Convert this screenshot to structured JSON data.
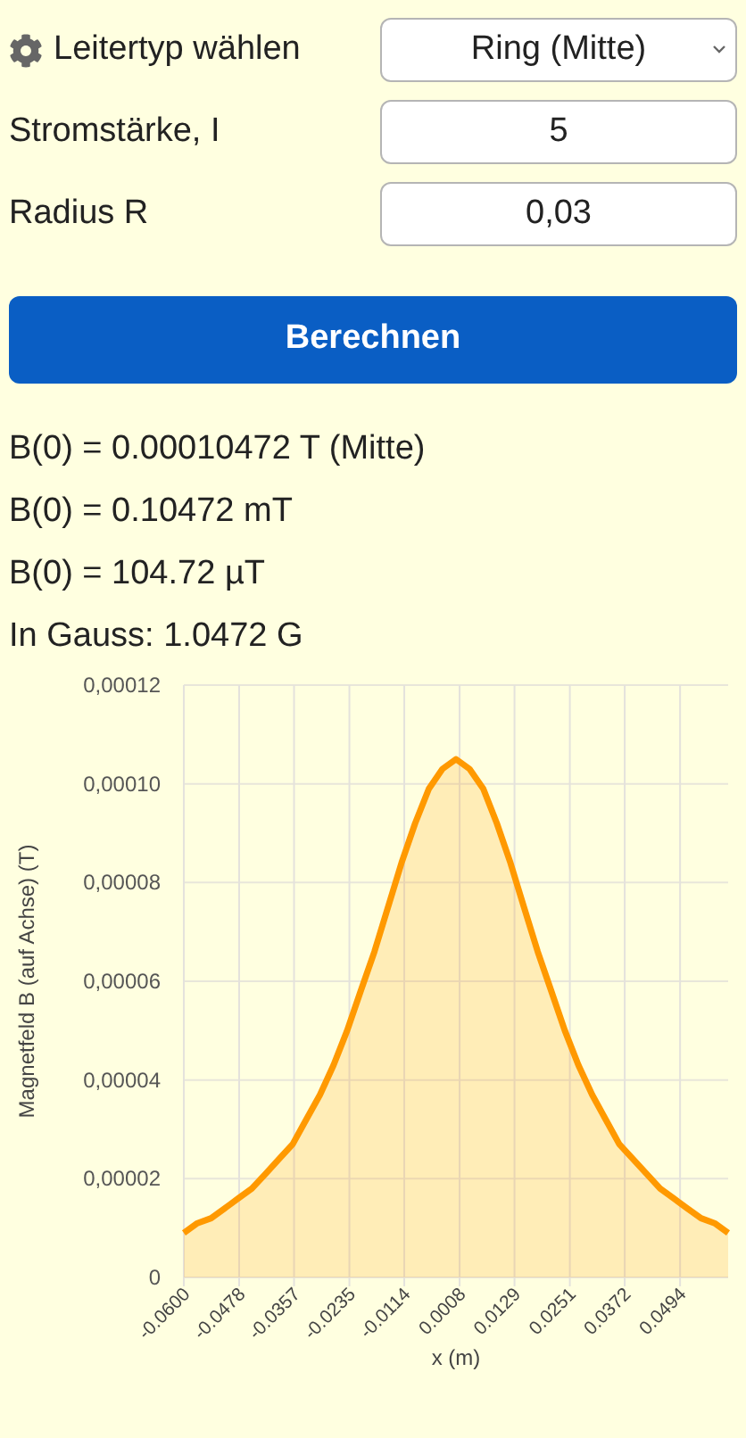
{
  "form": {
    "type_label": "Leitertyp wählen",
    "type_value": "Ring (Mitte)",
    "current_label": "Stromstärke, I",
    "current_value": "5",
    "radius_label": "Radius R",
    "radius_value": "0,03"
  },
  "button": "Berechnen",
  "results": [
    "B(0) = 0.00010472 T (Mitte)",
    "B(0) = 0.10472 mT",
    "B(0) = 104.72 µT",
    "In Gauss: 1.0472 G"
  ],
  "chart_data": {
    "type": "area",
    "xlabel": "x (m)",
    "ylabel": "Magnetfeld B (auf Achse) (T)",
    "x": [
      -0.06,
      -0.057,
      -0.054,
      -0.051,
      -0.048,
      -0.045,
      -0.042,
      -0.039,
      -0.036,
      -0.033,
      -0.03,
      -0.027,
      -0.024,
      -0.021,
      -0.018,
      -0.015,
      -0.012,
      -0.009,
      -0.006,
      -0.003,
      0,
      0.003,
      0.006,
      0.009,
      0.012,
      0.015,
      0.018,
      0.021,
      0.024,
      0.027,
      0.03,
      0.033,
      0.036,
      0.039,
      0.042,
      0.045,
      0.048,
      0.051,
      0.054,
      0.057,
      0.06
    ],
    "series": [
      {
        "color": "#ff9900",
        "values": [
          9e-06,
          1.1e-05,
          1.2e-05,
          1.4e-05,
          1.6e-05,
          1.8e-05,
          2.1e-05,
          2.4e-05,
          2.7e-05,
          3.2e-05,
          3.7e-05,
          4.3e-05,
          5e-05,
          5.8e-05,
          6.6e-05,
          7.5e-05,
          8.4e-05,
          9.2e-05,
          9.9e-05,
          0.000103,
          0.000105,
          0.000103,
          9.9e-05,
          9.2e-05,
          8.4e-05,
          7.5e-05,
          6.6e-05,
          5.8e-05,
          5e-05,
          4.3e-05,
          3.7e-05,
          3.2e-05,
          2.7e-05,
          2.4e-05,
          2.1e-05,
          1.8e-05,
          1.6e-05,
          1.4e-05,
          1.2e-05,
          1.1e-05,
          9e-06
        ]
      }
    ],
    "grid": true,
    "xlim": [
      -0.06,
      0.06
    ],
    "ylim": [
      0,
      0.00012
    ],
    "xticks": [
      {
        "value": -0.06,
        "label": "-0.0600"
      },
      {
        "value": -0.0478,
        "label": "-0.0478"
      },
      {
        "value": -0.0357,
        "label": "-0.0357"
      },
      {
        "value": -0.0235,
        "label": "-0.0235"
      },
      {
        "value": -0.0114,
        "label": "-0.0114"
      },
      {
        "value": 0.0008,
        "label": "0.0008"
      },
      {
        "value": 0.0129,
        "label": "0.0129"
      },
      {
        "value": 0.0251,
        "label": "0.0251"
      },
      {
        "value": 0.0372,
        "label": "0.0372"
      },
      {
        "value": 0.0494,
        "label": "0.0494"
      }
    ],
    "yticks": [
      {
        "value": 0,
        "label": "0"
      },
      {
        "value": 2e-05,
        "label": "0,00002"
      },
      {
        "value": 4e-05,
        "label": "0,00004"
      },
      {
        "value": 6e-05,
        "label": "0,00006"
      },
      {
        "value": 8e-05,
        "label": "0,00008"
      },
      {
        "value": 0.0001,
        "label": "0,00010"
      },
      {
        "value": 0.00012,
        "label": "0,00012"
      }
    ]
  }
}
